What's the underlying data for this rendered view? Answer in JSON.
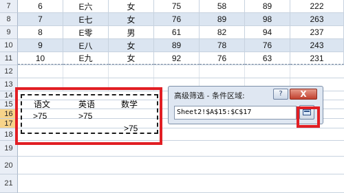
{
  "top_rows": [
    {
      "row": "7",
      "cells": [
        "6",
        "E六",
        "女",
        "75",
        "58",
        "89",
        "222"
      ]
    },
    {
      "row": "8",
      "cells": [
        "7",
        "E七",
        "女",
        "76",
        "89",
        "98",
        "263"
      ]
    },
    {
      "row": "9",
      "cells": [
        "8",
        "E零",
        "男",
        "61",
        "82",
        "94",
        "237"
      ]
    },
    {
      "row": "10",
      "cells": [
        "9",
        "E八",
        "女",
        "89",
        "78",
        "76",
        "243"
      ]
    },
    {
      "row": "11",
      "cells": [
        "10",
        "E九",
        "女",
        "92",
        "76",
        "63",
        "231"
      ]
    }
  ],
  "empty_rows": [
    "12",
    "13"
  ],
  "criteria_rows": [
    {
      "row": "14",
      "cells": [
        "",
        "",
        ""
      ]
    },
    {
      "row": "15",
      "cells": [
        "语文",
        "英语",
        "数学"
      ]
    },
    {
      "row": "16",
      "cells": [
        ">75",
        ">75",
        ""
      ]
    },
    {
      "row": "17",
      "cells": [
        "",
        "",
        ">75"
      ]
    },
    {
      "row": "18",
      "cells": [
        "",
        "",
        ""
      ]
    }
  ],
  "trailing_rows": [
    "19",
    "20",
    "21"
  ],
  "dialog": {
    "title": "高级筛选 - 条件区域:",
    "help_label": "?",
    "close_label": "X",
    "range_value": "Sheet2!$A$15:$C$17"
  },
  "colors": {
    "highlight_red": "#e11e24",
    "row_band_blue": "#dbe5f1",
    "active_row_header": "#f7d48a"
  }
}
